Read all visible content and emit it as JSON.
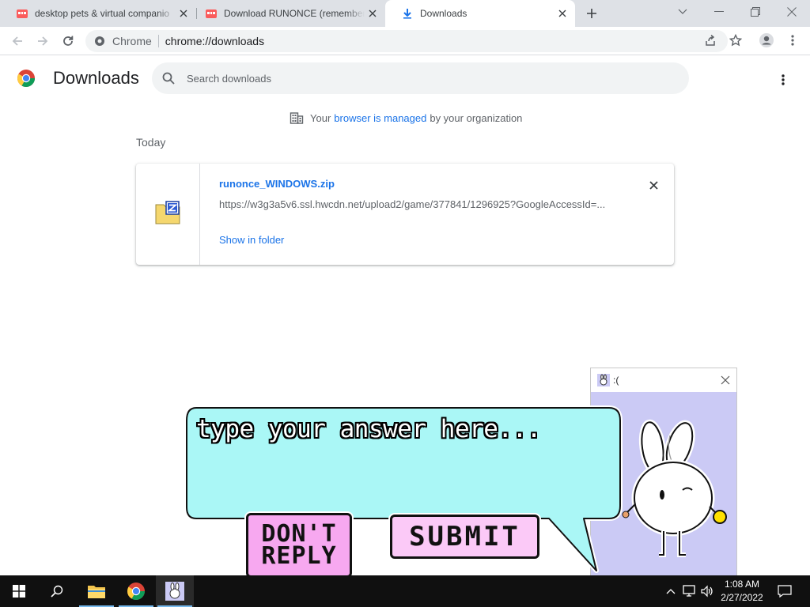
{
  "browser": {
    "tabs": [
      {
        "title": "desktop pets & virtual companio",
        "favicon": "itchio-icon",
        "active": false
      },
      {
        "title": "Download RUNONCE (remember",
        "favicon": "itchio-icon",
        "active": false
      },
      {
        "title": "Downloads",
        "favicon": "download-icon",
        "active": true
      }
    ],
    "omnibox": {
      "site_name": "Chrome",
      "url": "chrome://downloads"
    }
  },
  "downloads_page": {
    "title": "Downloads",
    "search_placeholder": "Search downloads",
    "managed_notice": {
      "prefix": "Your",
      "link": "browser is managed",
      "suffix": "by your organization"
    },
    "date_heading": "Today",
    "items": [
      {
        "filename": "runonce_WINDOWS.zip",
        "url": "https://w3g3a5v6.ssl.hwcdn.net/upload2/game/377841/1296925?GoogleAccessId=...",
        "action": "Show in folder"
      }
    ]
  },
  "game_window": {
    "title": ":(",
    "prompt": "type your answer here...",
    "dont_reply_line1": "DON'T",
    "dont_reply_line2": "REPLY",
    "submit_label": "SUBMIT"
  },
  "taskbar": {
    "time": "1:08 AM",
    "date": "2/27/2022"
  },
  "colors": {
    "link_blue": "#1a73e8",
    "bubble_cyan": "#aaf7f6",
    "game_bg": "#cbcaf5",
    "button_pink": "#f7a8f0",
    "button_pink_light": "#fbc9f7"
  }
}
